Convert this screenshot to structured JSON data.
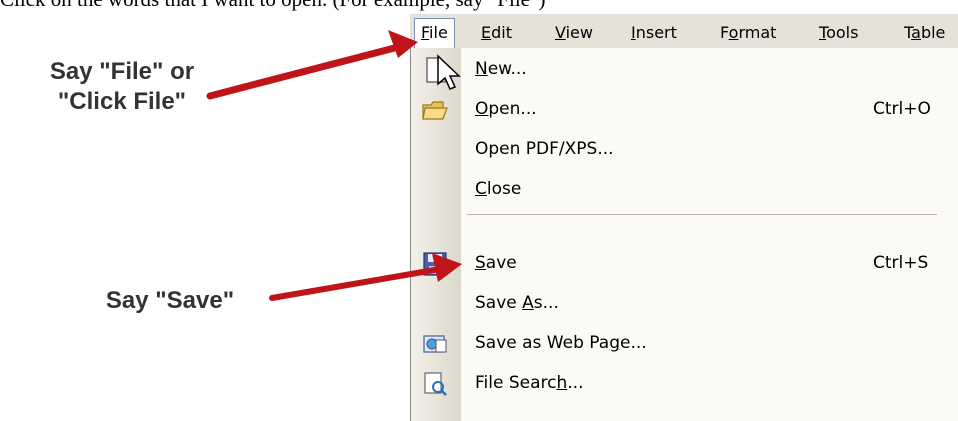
{
  "top_text": "Click on the words that I want to open. (For example, say \"File\")",
  "callouts": {
    "file_line1": "Say \"File\" or",
    "file_line2": "\"Click File\"",
    "save": "Say \"Save\""
  },
  "menubar": {
    "items": [
      {
        "label": "File",
        "ul_index": 0
      },
      {
        "label": "Edit",
        "ul_index": 0
      },
      {
        "label": "View",
        "ul_index": 0
      },
      {
        "label": "Insert",
        "ul_index": 0
      },
      {
        "label": "Format",
        "ul_index": 1
      },
      {
        "label": "Tools",
        "ul_index": 0
      },
      {
        "label": "Table",
        "ul_index": 1
      }
    ],
    "active": "File"
  },
  "file_menu": {
    "items": [
      {
        "label": "New...",
        "ul": "N",
        "shortcut": "",
        "icon": "new-document-icon"
      },
      {
        "label": "Open...",
        "ul": "O",
        "shortcut": "Ctrl+O",
        "icon": "open-folder-icon"
      },
      {
        "label": "Open PDF/XPS...",
        "ul": "",
        "shortcut": "",
        "icon": ""
      },
      {
        "label": "Close",
        "ul": "C",
        "shortcut": "",
        "icon": ""
      },
      {
        "label": "Save",
        "ul": "S",
        "shortcut": "Ctrl+S",
        "icon": "save-floppy-icon"
      },
      {
        "label": "Save As...",
        "ul": "A",
        "shortcut": "",
        "icon": ""
      },
      {
        "label": "Save as Web Page...",
        "ul": "g",
        "shortcut": "",
        "icon": "web-page-icon"
      },
      {
        "label": "File Search...",
        "ul": "h",
        "shortcut": "",
        "icon": "file-search-icon"
      }
    ]
  },
  "colors": {
    "arrow": "#c0141b",
    "menubar_bg": "#e6e2d8",
    "menu_bg": "#fbfaf6",
    "active_border": "#7b90bb"
  }
}
